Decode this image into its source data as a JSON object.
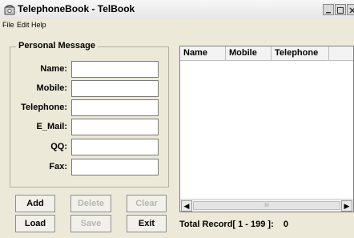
{
  "window": {
    "title": "TelephoneBook - TelBook",
    "icon": "phone-icon"
  },
  "menubar": {
    "items": [
      "File",
      "Edit",
      "Help"
    ]
  },
  "personal_message": {
    "group_title": "Personal Message",
    "fields": [
      {
        "label": "Name:",
        "value": ""
      },
      {
        "label": "Mobile:",
        "value": ""
      },
      {
        "label": "Telephone:",
        "value": ""
      },
      {
        "label": "E_Mail:",
        "value": ""
      },
      {
        "label": "QQ:",
        "value": ""
      },
      {
        "label": "Fax:",
        "value": ""
      }
    ]
  },
  "buttons": {
    "add": "Add",
    "delete": "Delete",
    "clear": "Clear",
    "load": "Load",
    "save": "Save",
    "exit": "Exit"
  },
  "list": {
    "columns": [
      "Name",
      "Mobile",
      "Telephone"
    ],
    "scroll_thumb_text": "III"
  },
  "status": {
    "total_record_label": "Total Record[ 1 - 199 ]:",
    "total_record_value": "0"
  }
}
